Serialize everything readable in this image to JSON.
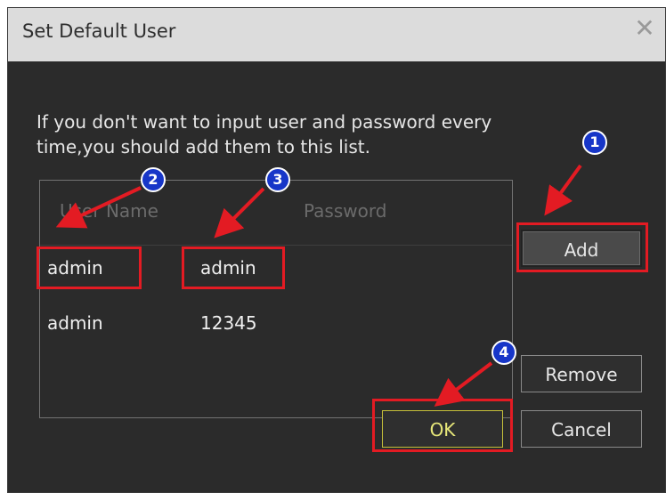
{
  "dialog": {
    "title": "Set Default User",
    "close_icon": "close-icon",
    "instructions_line1": "If you don't want to input user and password every",
    "instructions_line2": "time,you should add them to this list."
  },
  "user_list": {
    "columns": [
      "User Name",
      "Password"
    ],
    "rows": [
      {
        "user": "admin",
        "password": "admin"
      },
      {
        "user": "admin",
        "password": "12345"
      }
    ]
  },
  "buttons": {
    "add": "Add",
    "remove": "Remove",
    "ok": "OK",
    "cancel": "Cancel"
  },
  "annotations": {
    "badges": [
      "1",
      "2",
      "3",
      "4"
    ],
    "highlight_color": "#e31b23",
    "badge_color": "#1736c8"
  },
  "colors": {
    "background": "#2b2b2b",
    "titlebar": "#dcdcdc",
    "text": "#e6e6e6",
    "ok_border": "#c6c03a"
  }
}
